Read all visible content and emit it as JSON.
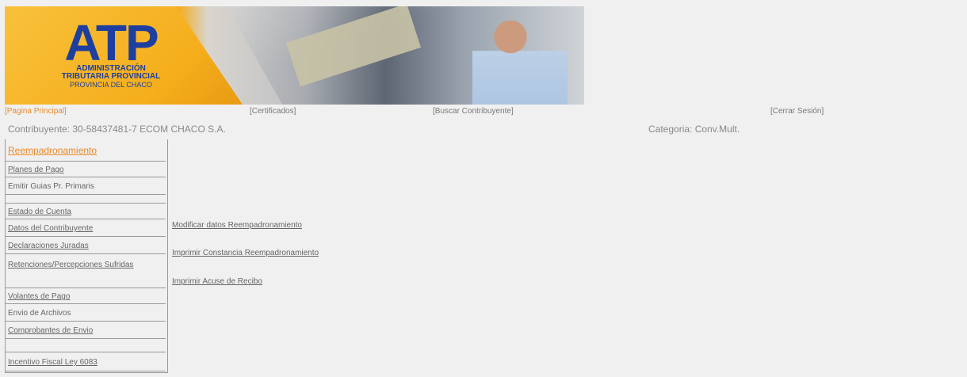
{
  "banner": {
    "logo_big": "ATP",
    "logo_line1": "ADMINISTRACIÓN",
    "logo_line2": "TRIBUTARIA PROVINCIAL",
    "logo_line3": "PROVINCIA DEL CHACO"
  },
  "topnav": {
    "home": "[Pagina Principal]",
    "certificates": "[Certificados]",
    "search": "[Buscar Contribuyente]",
    "logout": "[Cerrar Sesión]"
  },
  "info": {
    "contributor": "Contribuyente: 30-58437481-7 ECOM CHACO S.A.",
    "category": "Categoria: Conv.Mult."
  },
  "sidebar": {
    "items": [
      "Reempadronamiento",
      "Planes de Pago",
      "Emitir Guias Pr. Primaris",
      "",
      "Estado de Cuenta",
      "Datos del Contribuyente",
      "Declaraciones Juradas",
      "Retenciones/Percepciones Sufridas",
      "Volantes de Pago",
      "Envio de Archivos",
      "Comprobantes de Envio",
      "",
      "Incentivo Fiscal Ley 6083"
    ]
  },
  "main": {
    "links": [
      "Modificar datos Reempadronamiento",
      "Imprimir Constancia Reempadronamiento",
      "Imprimir Acuse de Recibo"
    ]
  }
}
